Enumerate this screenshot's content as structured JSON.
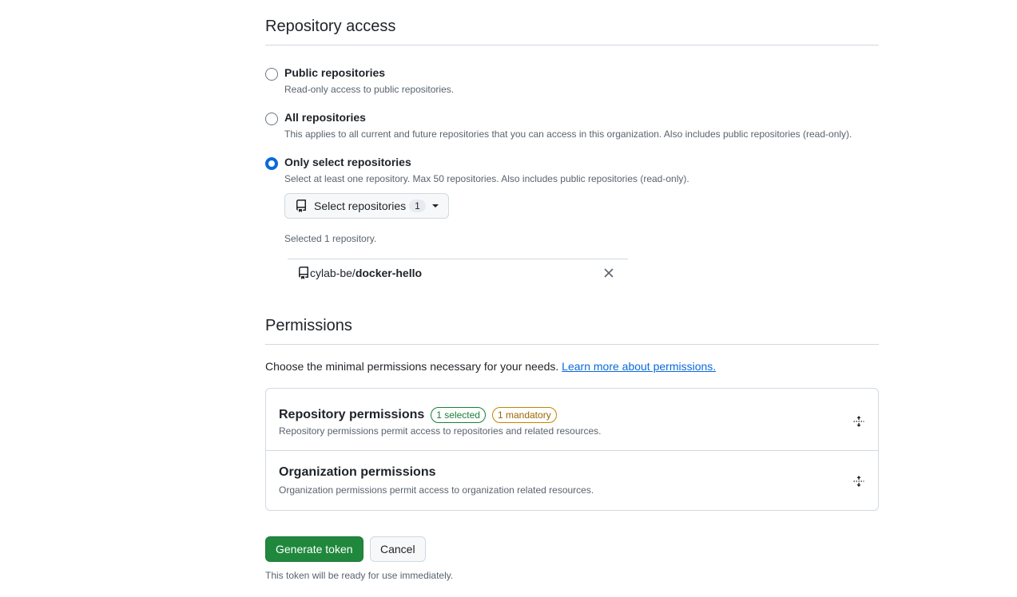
{
  "repository_access": {
    "title": "Repository access",
    "options": [
      {
        "label": "Public repositories",
        "description": "Read-only access to public repositories.",
        "checked": false
      },
      {
        "label": "All repositories",
        "description": "This applies to all current and future repositories that you can access in this organization. Also includes public repositories (read-only).",
        "checked": false
      },
      {
        "label": "Only select repositories",
        "description": "Select at least one repository. Max 50 repositories. Also includes public repositories (read-only).",
        "checked": true
      }
    ],
    "select_button": {
      "label": "Select repositories",
      "count": "1",
      "icon": "repo-icon"
    },
    "selected_summary": "Selected 1 repository.",
    "selected_repos": [
      {
        "owner": "cylab-be/",
        "name": "docker-hello"
      }
    ]
  },
  "permissions": {
    "title": "Permissions",
    "intro": "Choose the minimal permissions necessary for your needs.",
    "learn_more": "Learn more about permissions.",
    "groups": [
      {
        "name": "Repository permissions",
        "badges": [
          "1 selected",
          "1 mandatory"
        ],
        "description": "Repository permissions permit access to repositories and related resources."
      },
      {
        "name": "Organization permissions",
        "badges": [],
        "description": "Organization permissions permit access to organization related resources."
      }
    ]
  },
  "actions": {
    "generate": "Generate token",
    "cancel": "Cancel",
    "note": "This token will be ready for use immediately."
  },
  "colors": {
    "accent": "#0969da",
    "primary_button": "#1f883d",
    "badge_green": "#1a7f37",
    "badge_amber": "#9a6700"
  }
}
